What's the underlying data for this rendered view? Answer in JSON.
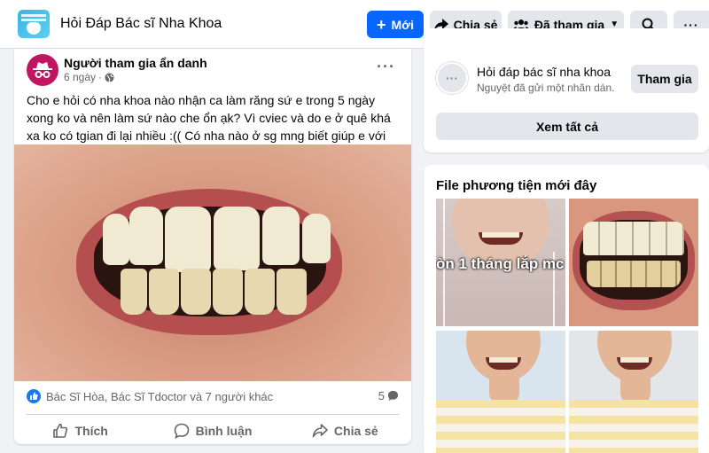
{
  "header": {
    "group_title": "Hỏi Đáp Bác sĩ Nha Khoa",
    "new_label": "Mới",
    "share_label": "Chia sẻ",
    "joined_label": "Đã tham gia",
    "more_label": "···",
    "brand_color": "#0866ff"
  },
  "post": {
    "author": "Người tham gia ẩn danh",
    "time": "6 ngày",
    "privacy_icon": "globe-icon",
    "more_label": "···",
    "text": "Cho e hỏi có nha khoa nào nhận ca làm răng sứ e trong 5 ngày xong ko và nên làm sứ nào che ổn ạk? Vì cviec và do e ở quê khá xa ko có tgian đi lại nhiều :(( Có nha nào ở sg mng biết giúp e với",
    "photo_icon": "teeth-photo",
    "reactions_text": "Bác Sĩ Hòa, Bác Sĩ Tdoctor và 7 người khác",
    "comments_count": "5",
    "actions": {
      "like": "Thích",
      "comment": "Bình luận",
      "share": "Chia sẻ"
    }
  },
  "sidebar": {
    "suggested": {
      "name": "Hỏi đáp bác sĩ nha khoa",
      "subtitle": "Nguyệt đã gửi một nhãn dán.",
      "join_label": "Tham gia",
      "see_all_label": "Xem tất cả"
    },
    "media": {
      "title": "File phương tiện mới đây",
      "thumb1_caption": "òn 1 tháng lắp mc"
    }
  }
}
